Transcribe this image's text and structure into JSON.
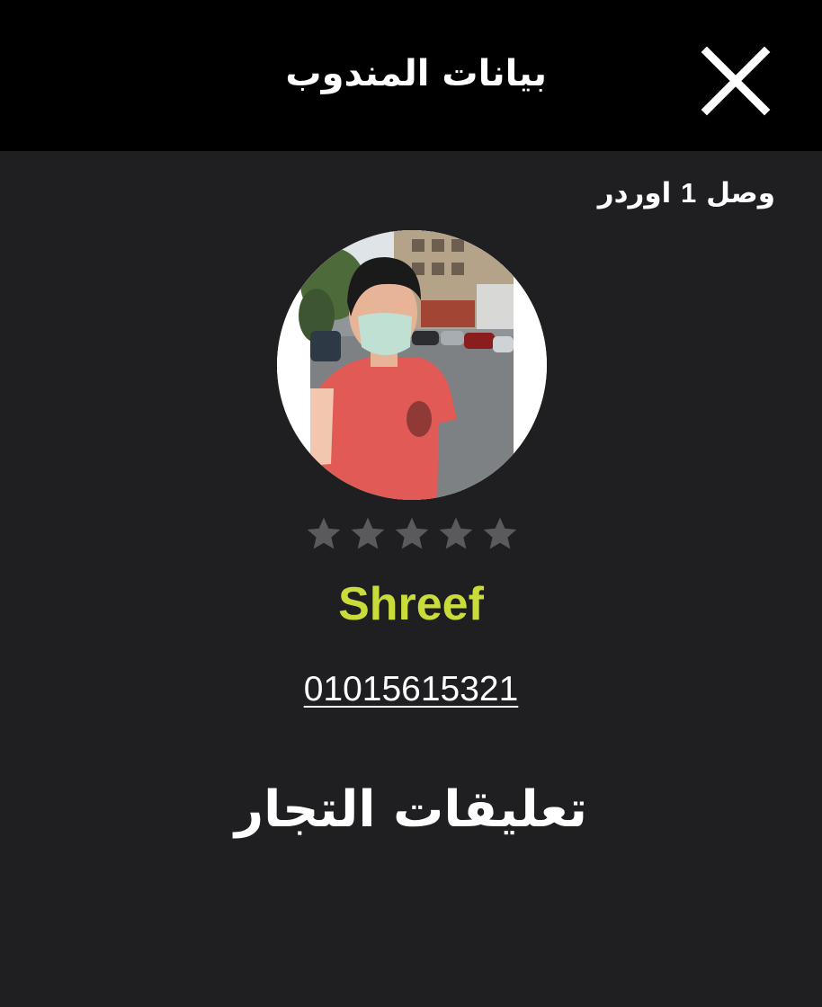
{
  "header": {
    "title": "بيانات المندوب",
    "close_icon": "close-icon"
  },
  "orders": {
    "prefix": "وصل",
    "count": "1",
    "suffix": "اوردر"
  },
  "agent": {
    "avatar_icon": "profile-photo",
    "rating": 0,
    "rating_max": 5,
    "name": "Shreef",
    "phone": "01015615321"
  },
  "reviews": {
    "heading": "تعليقات التجار"
  },
  "colors": {
    "header_bg": "#000000",
    "page_bg": "#1f1f21",
    "accent_name": "#c9dc3a",
    "star_empty": "#5a5a5c",
    "text": "#ffffff"
  }
}
